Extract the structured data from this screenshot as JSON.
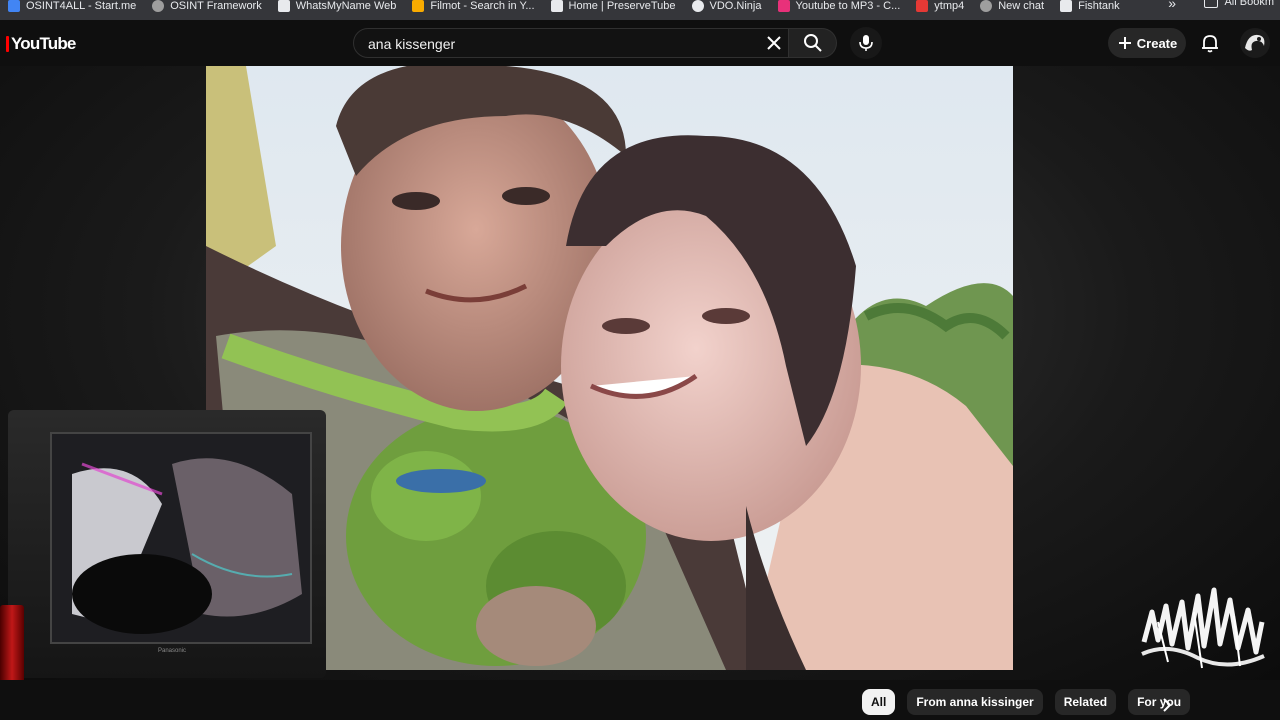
{
  "bookmarks": {
    "items": [
      {
        "label": "OSINT4ALL - Start.me",
        "color": "#4285f4"
      },
      {
        "label": "OSINT Framework",
        "color": "#9e9e9e"
      },
      {
        "label": "WhatsMyName Web",
        "color": "#e8eaed"
      },
      {
        "label": "Filmot - Search in Y...",
        "color": "#f9ab00"
      },
      {
        "label": "Home | PreserveTube",
        "color": "#e8eaed"
      },
      {
        "label": "VDO.Ninja",
        "color": "#e8eaed"
      },
      {
        "label": "Youtube to MP3 - C...",
        "color": "#e8317a"
      },
      {
        "label": "ytmp4",
        "color": "#e53935"
      },
      {
        "label": "New chat",
        "color": "#9e9e9e"
      },
      {
        "label": "Fishtank",
        "color": "#e8eaed"
      }
    ],
    "more": "»",
    "all_label": "All Bookm"
  },
  "masthead": {
    "logo": "YouTube",
    "search": {
      "value": "ana kissenger"
    },
    "create_label": "Create"
  },
  "tv": {
    "brand": "Panasonic"
  },
  "chips": [
    "All",
    "From anna kissinger",
    "Related",
    "For you"
  ],
  "colors": {
    "accent": "#ff0000",
    "background": "#0f0f0f",
    "chip": "#272727"
  }
}
